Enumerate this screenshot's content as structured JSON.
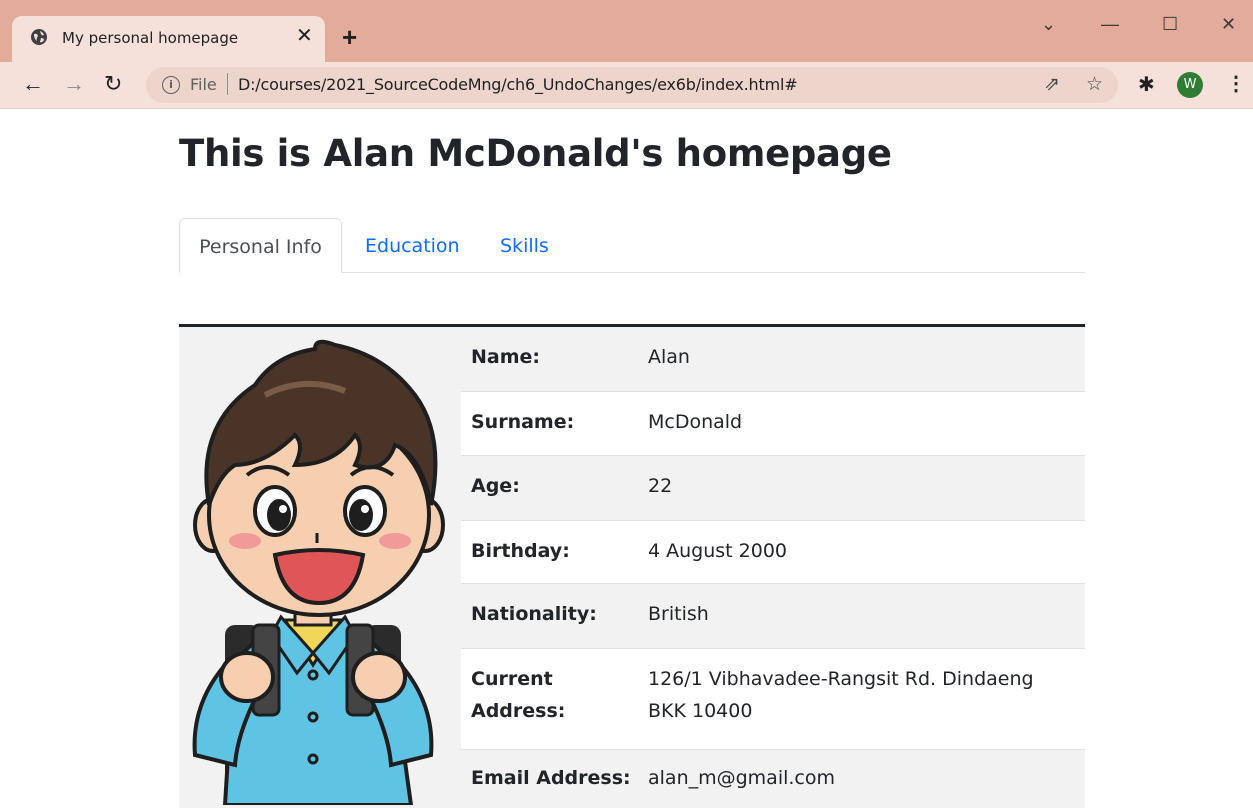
{
  "browser": {
    "tab_title": "My personal homepage",
    "url_scheme": "File",
    "url": "D:/courses/2021_SourceCodeMng/ch6_UndoChanges/ex6b/index.html#",
    "profile_initial": "W"
  },
  "page": {
    "title": "This is Alan McDonald's homepage",
    "tabs": [
      {
        "label": "Personal Info",
        "active": true
      },
      {
        "label": "Education",
        "active": false
      },
      {
        "label": "Skills",
        "active": false
      }
    ],
    "info": [
      {
        "label": "Name:",
        "value": "Alan"
      },
      {
        "label": "Surname:",
        "value": "McDonald"
      },
      {
        "label": "Age:",
        "value": "22"
      },
      {
        "label": "Birthday:",
        "value": "4 August 2000"
      },
      {
        "label": "Nationality:",
        "value": "British"
      },
      {
        "label": "Current Address:",
        "value": "126/1 Vibhavadee-Rangsit Rd. Dindaeng BKK 10400"
      },
      {
        "label": "Email Address:",
        "value": "alan_m@gmail.com"
      }
    ]
  },
  "colors": {
    "chrome_frame": "#e3ab9a",
    "chrome_toolbar": "#f6e1da",
    "link": "#0d6efd",
    "text": "#212529",
    "stripe": "#f2f2f2"
  }
}
